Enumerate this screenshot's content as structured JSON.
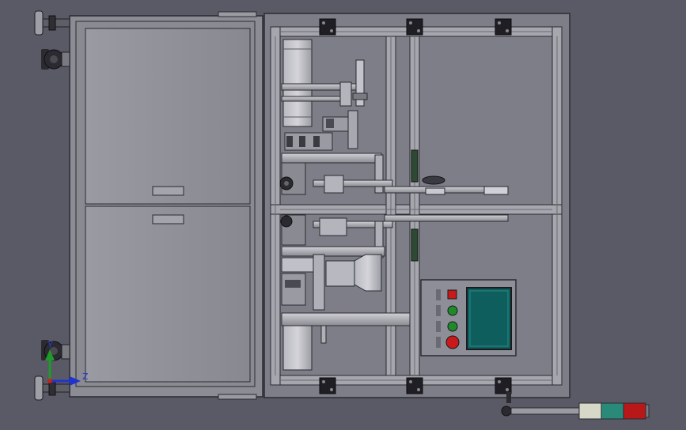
{
  "view": {
    "background_color": "#5a5a66",
    "frame_color": "#9a9aa2",
    "panel_color": "#8e8e96",
    "profile_color": "#a6a6ae"
  },
  "axis_triad": {
    "y_label": "Y",
    "z_label": "Z",
    "y_color": "#1f9a2a",
    "z_color": "#2233cc"
  },
  "control_panel": {
    "screen_color": "#0f5e5e",
    "buttons": [
      {
        "name": "stop",
        "color": "#c81a1a",
        "shape": "square"
      },
      {
        "name": "start",
        "color": "#1f8a2a",
        "shape": "round"
      },
      {
        "name": "reset",
        "color": "#1f8a2a",
        "shape": "round"
      },
      {
        "name": "emergency",
        "color": "#c81a1a",
        "shape": "round"
      }
    ]
  },
  "signal_tower": {
    "segments": [
      "#d8d8c8",
      "#2a8a7a",
      "#b81818"
    ]
  }
}
